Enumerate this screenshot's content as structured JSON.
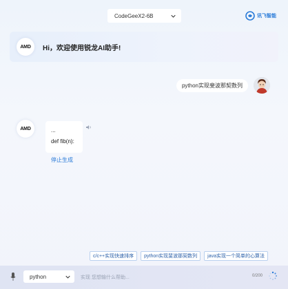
{
  "header": {
    "model_select_value": "CodeGeeX2-6B",
    "brand_text": "讯飞智能"
  },
  "welcome": {
    "avatar_logo": "AMD",
    "text": "Hi，欢迎使用锐龙AI助手!"
  },
  "conversation": {
    "user_message": "python实现斐波那契数列",
    "bot_avatar_logo": "AMD",
    "bot_line_1": "...",
    "bot_line_2": "def fib(n):",
    "stop_label": "停止生成"
  },
  "suggestions": [
    "c/c++实现快速排序",
    "python实现斐波那契数列",
    "java实现一个简单的心算法"
  ],
  "input": {
    "language_value": "python",
    "placeholder": "实现  您想输什么帮助...",
    "counter": "0/200"
  },
  "colors": {
    "accent": "#2a7bd8",
    "chip_border": "#b9d0ee",
    "input_bar": "#e1e5f3"
  }
}
